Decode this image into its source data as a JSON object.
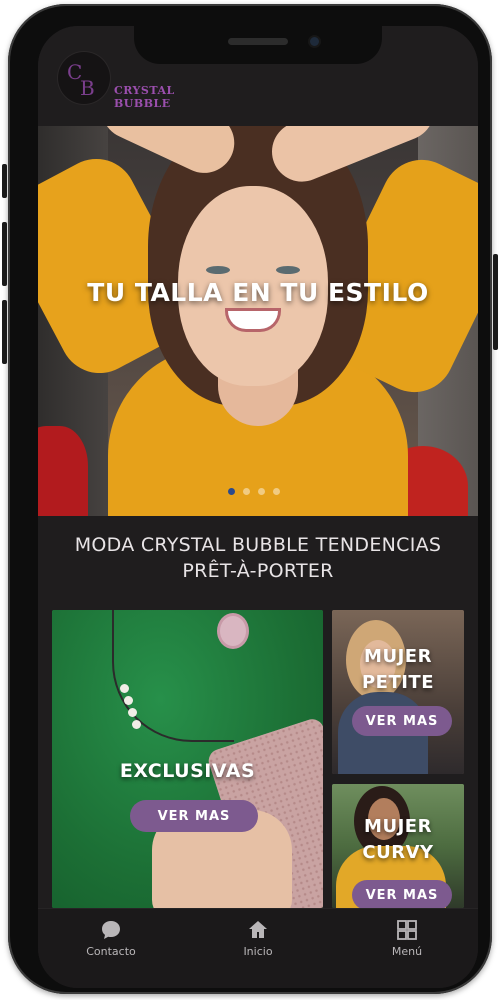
{
  "header": {
    "logo_letters": {
      "first": "C",
      "second": "B"
    },
    "brand_name": "CRYSTAL BUBBLE"
  },
  "hero": {
    "title": "TU TALLA EN TU ESTILO",
    "carousel": {
      "slide_count": 4,
      "active_index": 0
    }
  },
  "section": {
    "title_line1": "MODA CRYSTAL BUBBLE TENDENCIAS",
    "title_line2": "PRÊT-À-PORTER"
  },
  "cards": [
    {
      "label": "EXCLUSIVAS",
      "button": "VER MAS"
    },
    {
      "label_line1": "MUJER",
      "label_line2": "PETITE",
      "button": "VER MAS"
    },
    {
      "label_line1": "MUJER",
      "label_line2": "CURVY",
      "button": "VER MAS"
    }
  ],
  "bottom_nav": {
    "items": [
      {
        "label": "Contacto",
        "icon": "chat-bubble-icon"
      },
      {
        "label": "Inicio",
        "icon": "home-icon"
      },
      {
        "label": "Menú",
        "icon": "grid-menu-icon"
      }
    ]
  },
  "colors": {
    "brand_purple": "#9b4fae",
    "button_purple": "#7d5a8f",
    "background": "#1f1d1e"
  }
}
